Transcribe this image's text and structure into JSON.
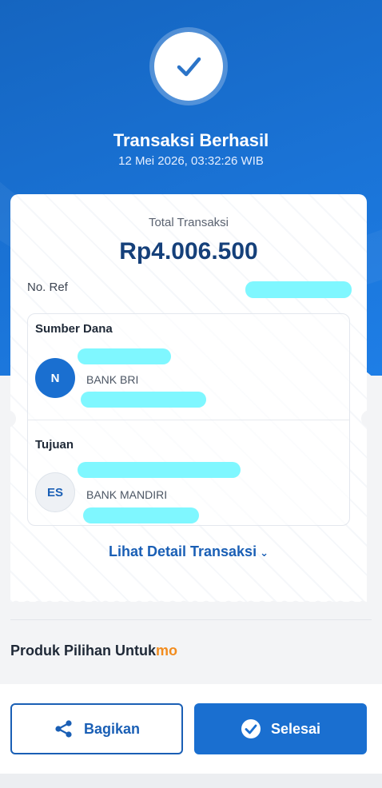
{
  "status": {
    "title": "Transaksi Berhasil",
    "datetime": "12 Mei 2026, 03:32:26 WIB"
  },
  "receipt": {
    "total_label": "Total Transaksi",
    "total_amount": "Rp4.006.500",
    "ref_label": "No. Ref"
  },
  "source": {
    "label": "Sumber Dana",
    "initials": "N",
    "bank": "BANK BRI"
  },
  "destination": {
    "label": "Tujuan",
    "initials": "ES",
    "bank": "BANK MANDIRI"
  },
  "detail_link": "Lihat Detail Transaksi",
  "products": {
    "title": "Produk Pilihan Untuk",
    "brand": "mo"
  },
  "buttons": {
    "share": "Bagikan",
    "done": "Selesai"
  },
  "colors": {
    "primary": "#1a6fd0",
    "navy": "#15407a",
    "brand_orange": "#f28c1e",
    "redaction": "#7ff7ff"
  }
}
